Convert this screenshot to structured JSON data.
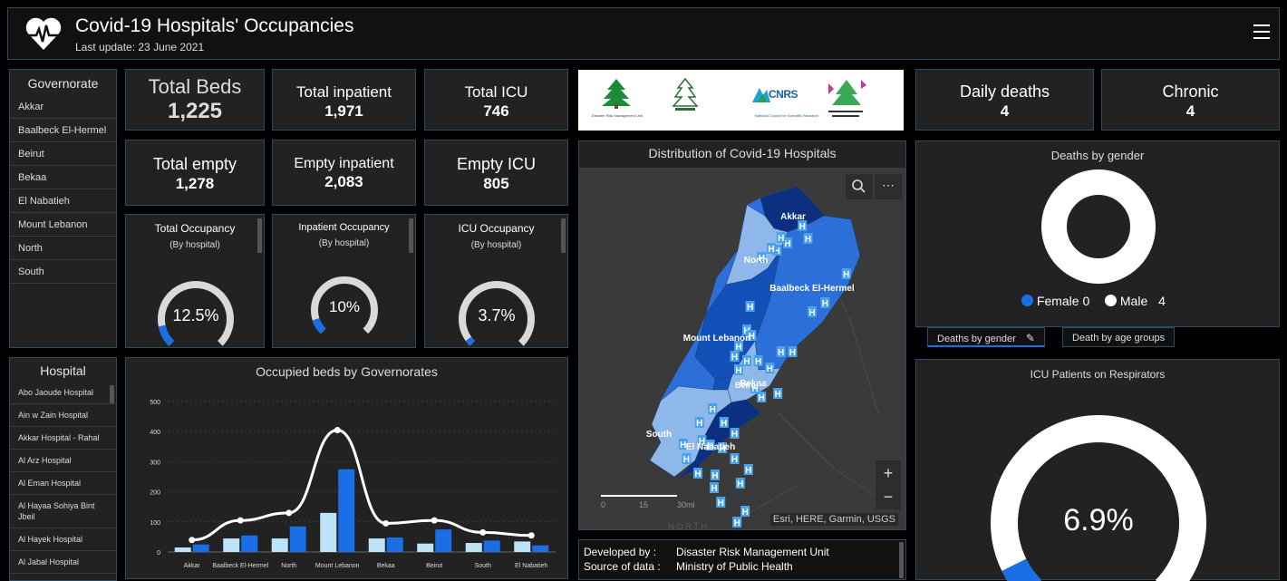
{
  "header": {
    "title": "Covid-19 Hospitals' Occupancies",
    "update": "Last update: 23 June 2021"
  },
  "governorate": {
    "title": "Governorate",
    "items": [
      "Akkar",
      "Baalbeck El-Hermel",
      "Beirut",
      "Bekaa",
      "El Nabatieh",
      "Mount Lebanon",
      "North",
      "South"
    ]
  },
  "hospital": {
    "title": "Hospital",
    "items": [
      "Abo Jaoude Hospital",
      "Ain w Zain Hospital",
      "Akkar Hospital - Rahal",
      "Al Arz Hospital",
      "Al Eman Hospital",
      "Al Hayaa Sohiya Bint Jbeil",
      "Al Hayek Hospital",
      "Al Jabal Hospital"
    ]
  },
  "stats": {
    "total_beds": {
      "label": "Total Beds",
      "value": "1,225"
    },
    "total_inpatient": {
      "label": "Total inpatient",
      "value": "1,971"
    },
    "total_icu": {
      "label": "Total ICU",
      "value": "746"
    },
    "total_empty": {
      "label": "Total empty",
      "value": "1,278"
    },
    "empty_inpatient": {
      "label": "Empty inpatient",
      "value": "2,083"
    },
    "empty_icu": {
      "label": "Empty ICU",
      "value": "805"
    },
    "daily_deaths": {
      "label": "Daily deaths",
      "value": "4"
    },
    "chronic": {
      "label": "Chronic",
      "value": "4"
    }
  },
  "gauges": {
    "total": {
      "title": "Total Occupancy",
      "sub": "(By hospital)",
      "value": "12.5%",
      "fraction": 0.125
    },
    "inpatient": {
      "title": "Inpatient Occupancy",
      "sub": "(By hospital)",
      "value": "10%",
      "fraction": 0.1
    },
    "icu": {
      "title": "ICU Occupancy",
      "sub": "(By hospital)",
      "value": "3.7%",
      "fraction": 0.037
    },
    "respirators": {
      "title": "ICU Patients on Respirators",
      "value": "6.9%",
      "fraction": 0.069
    }
  },
  "logos": {
    "drm": "Disaster Risk Management Unit",
    "cnrs": "CNRS",
    "cnrs_sub": "National Council for Scientific Research"
  },
  "map": {
    "title": "Distribution of Covid-19 Hospitals",
    "labels": [
      "Akkar",
      "North",
      "Baalbeck El-Hermel",
      "Mount Lebanon",
      "Beirut",
      "Bekaa",
      "South",
      "El Nabatieh"
    ],
    "attribution": "Esri, HERE, Garmin, USGS",
    "scale": [
      "0",
      "15",
      "30mi"
    ],
    "north_label": "NORTH",
    "zoom_in": "+",
    "zoom_out": "−"
  },
  "credits": {
    "dev_label": "Developed by :",
    "dev_value": "Disaster Risk Management Unit",
    "src_label": "Source of data :",
    "src_value": "Ministry of Public Health"
  },
  "deaths_gender": {
    "title": "Deaths by gender",
    "female_label": "Female",
    "female_value": "0",
    "male_label": "Male",
    "male_value": "4",
    "tabs": [
      "Deaths by gender",
      "Death by age groups"
    ]
  },
  "colors": {
    "accent": "#1a6fe6",
    "light_bar": "#bde3f9",
    "panel": "#222222",
    "border": "#2c4b63"
  },
  "chart_data": {
    "type": "bar",
    "title": "Occupied beds by Governorates",
    "categories": [
      "Akkar",
      "Baalbeck El-Hermel",
      "North",
      "Mount Lebanon",
      "Bekaa",
      "Beirut",
      "South",
      "El Nabatieh"
    ],
    "ylim": [
      0,
      500
    ],
    "yticks": [
      0,
      100,
      200,
      300,
      400,
      500
    ],
    "series": [
      {
        "type": "bar",
        "color": "#bde3f9",
        "values": [
          15,
          45,
          45,
          130,
          45,
          28,
          30,
          35
        ]
      },
      {
        "type": "bar",
        "color": "#1a6fe6",
        "values": [
          25,
          55,
          85,
          275,
          48,
          75,
          38,
          22
        ]
      },
      {
        "type": "line",
        "color": "#ffffff",
        "values": [
          40,
          105,
          130,
          405,
          95,
          105,
          65,
          55
        ]
      }
    ],
    "grid": true
  }
}
